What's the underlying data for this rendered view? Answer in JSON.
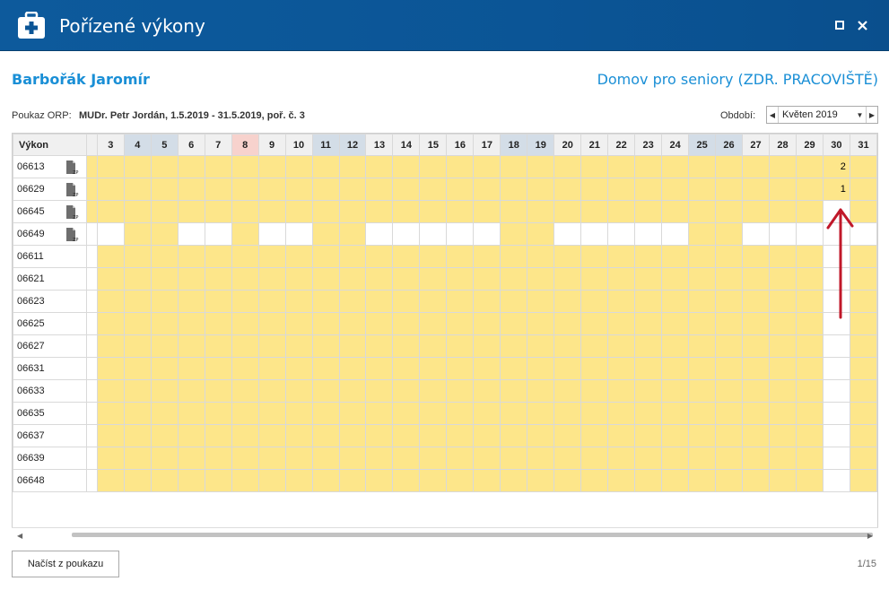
{
  "window": {
    "title": "Pořízené výkony",
    "icon": "medical-kit-icon"
  },
  "patient": {
    "name": "Barbořák Jaromír",
    "facility": "Domov pro seniory (ZDR. PRACOVIŠTĚ)"
  },
  "orp": {
    "label": "Poukaz ORP:",
    "value": "MUDr. Petr Jordán, 1.5.2019 - 31.5.2019, poř. č. 3"
  },
  "period": {
    "label": "Období:",
    "value": "Květen 2019"
  },
  "grid": {
    "header_label": "Výkon",
    "days": [
      "3",
      "4",
      "5",
      "6",
      "7",
      "8",
      "9",
      "10",
      "11",
      "12",
      "13",
      "14",
      "15",
      "16",
      "17",
      "18",
      "19",
      "20",
      "21",
      "22",
      "23",
      "24",
      "25",
      "26",
      "27",
      "28",
      "29",
      "30",
      "31"
    ],
    "weekend_days": [
      "4",
      "5",
      "11",
      "12",
      "18",
      "19",
      "25",
      "26"
    ],
    "holiday_days": [
      "8"
    ],
    "rows": [
      {
        "code": "06613",
        "doc_icon": true,
        "day30": "2"
      },
      {
        "code": "06629",
        "doc_icon": true,
        "day30": "1"
      },
      {
        "code": "06645",
        "doc_icon": true,
        "day30": ""
      },
      {
        "code": "06649",
        "doc_icon": true,
        "day30": ""
      },
      {
        "code": "06611",
        "doc_icon": false,
        "day30": ""
      },
      {
        "code": "06621",
        "doc_icon": false,
        "day30": ""
      },
      {
        "code": "06623",
        "doc_icon": false,
        "day30": ""
      },
      {
        "code": "06625",
        "doc_icon": false,
        "day30": ""
      },
      {
        "code": "06627",
        "doc_icon": false,
        "day30": ""
      },
      {
        "code": "06631",
        "doc_icon": false,
        "day30": ""
      },
      {
        "code": "06633",
        "doc_icon": false,
        "day30": ""
      },
      {
        "code": "06635",
        "doc_icon": false,
        "day30": ""
      },
      {
        "code": "06637",
        "doc_icon": false,
        "day30": ""
      },
      {
        "code": "06639",
        "doc_icon": false,
        "day30": ""
      },
      {
        "code": "06648",
        "doc_icon": false,
        "day30": ""
      }
    ],
    "doc_icon_label": "ZP"
  },
  "buttons": {
    "load": "Načíst z poukazu"
  },
  "pager": {
    "text": "1/15"
  },
  "colors": {
    "titlebar": "#0b5596",
    "accent": "#1a8fd6",
    "cell_yellow": "#fde68a",
    "weekend_header": "#d3dde7",
    "holiday_header": "#f7d2cd",
    "annotation": "#c0182a"
  }
}
